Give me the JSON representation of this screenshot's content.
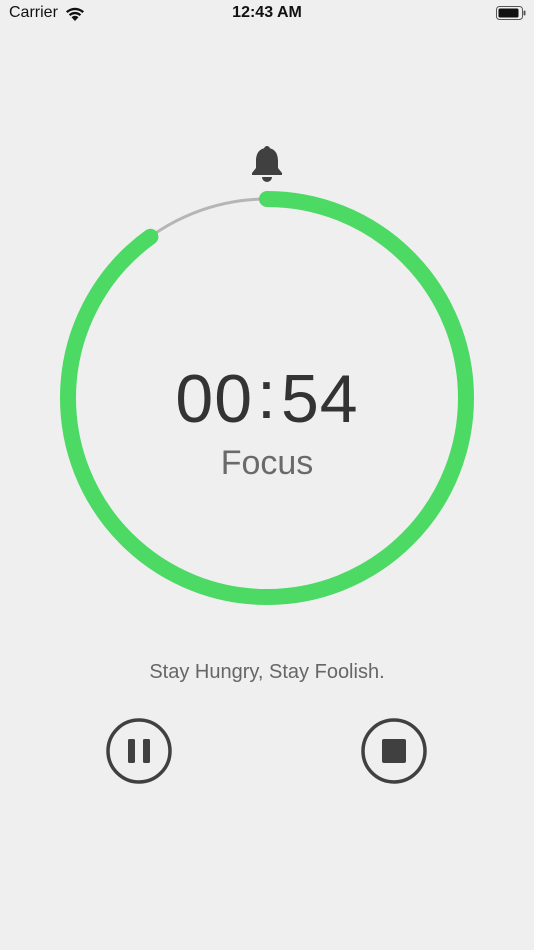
{
  "status_bar": {
    "carrier": "Carrier",
    "time": "12:43 AM",
    "wifi_icon": "wifi-icon",
    "battery_icon": "battery-icon"
  },
  "timer": {
    "minutes": "00",
    "separator": ":",
    "seconds": "54",
    "mode": "Focus",
    "progress_fraction": 0.9,
    "ring_color": "#4cd964",
    "track_color": "#b5b5b5"
  },
  "bell_icon": "bell-icon",
  "motto": "Stay Hungry, Stay Foolish.",
  "controls": {
    "pause_icon": "pause-icon",
    "stop_icon": "stop-icon",
    "icon_color": "#404040"
  }
}
